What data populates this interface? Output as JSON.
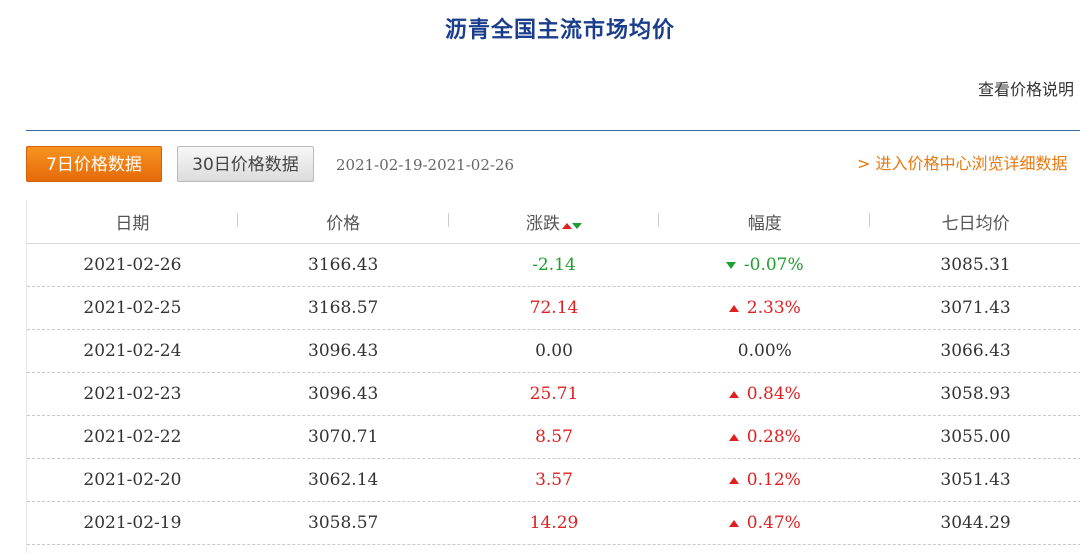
{
  "title": "沥青全国主流市场均价",
  "help_link": "查看价格说明",
  "tabs": [
    {
      "label": "7日价格数据",
      "active": true
    },
    {
      "label": "30日价格数据",
      "active": false
    }
  ],
  "date_range": "2021-02-19-2021-02-26",
  "price_center_link": "> 进入价格中心浏览详细数据",
  "colors": {
    "up": "#e02020",
    "down": "#1e9e2e",
    "accent": "#f7931e",
    "title": "#1a3e8c"
  },
  "table": {
    "headers": [
      "日期",
      "价格",
      "涨跌",
      "幅度",
      "七日均价"
    ],
    "rows": [
      {
        "date": "2021-02-26",
        "price": "3166.43",
        "change": "-2.14",
        "pct": "-0.07%",
        "dir": "down",
        "avg7": "3085.31"
      },
      {
        "date": "2021-02-25",
        "price": "3168.57",
        "change": "72.14",
        "pct": "2.33%",
        "dir": "up",
        "avg7": "3071.43"
      },
      {
        "date": "2021-02-24",
        "price": "3096.43",
        "change": "0.00",
        "pct": "0.00%",
        "dir": "flat",
        "avg7": "3066.43"
      },
      {
        "date": "2021-02-23",
        "price": "3096.43",
        "change": "25.71",
        "pct": "0.84%",
        "dir": "up",
        "avg7": "3058.93"
      },
      {
        "date": "2021-02-22",
        "price": "3070.71",
        "change": "8.57",
        "pct": "0.28%",
        "dir": "up",
        "avg7": "3055.00"
      },
      {
        "date": "2021-02-20",
        "price": "3062.14",
        "change": "3.57",
        "pct": "0.12%",
        "dir": "up",
        "avg7": "3051.43"
      },
      {
        "date": "2021-02-19",
        "price": "3058.57",
        "change": "14.29",
        "pct": "0.47%",
        "dir": "up",
        "avg7": "3044.29"
      }
    ]
  }
}
